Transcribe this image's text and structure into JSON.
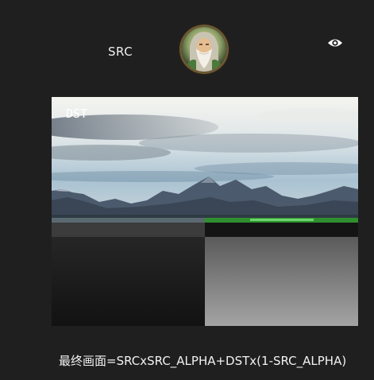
{
  "src_label": "SRC",
  "dst_label": "DST",
  "formula": "最终画面=SRCxSRC_ALPHA+DSTx(1-SRC_ALPHA)",
  "icons": {
    "avatar": "wizard-portrait-avatar",
    "visibility": "eye-icon"
  },
  "colors": {
    "background": "#1f1f1f",
    "avatar_ring": "#6b5a34",
    "text": "#f0f0f0"
  }
}
